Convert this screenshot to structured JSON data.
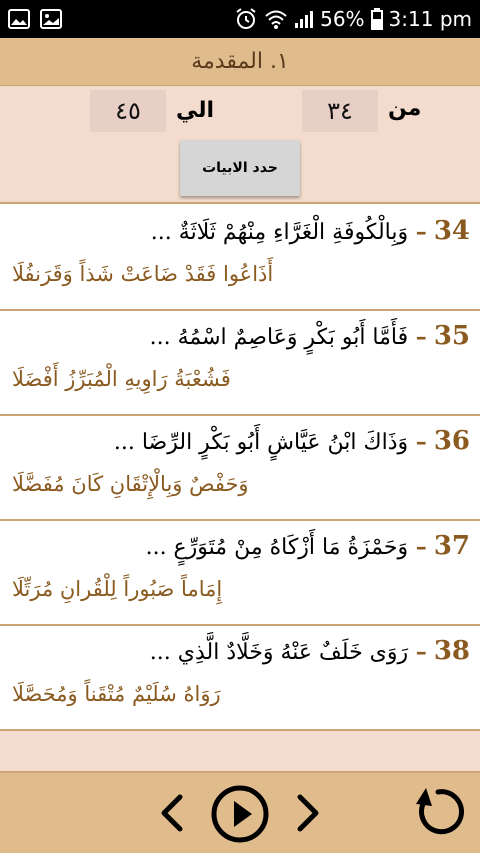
{
  "status_bar": {
    "battery_percent": "56%",
    "time": "3:11 pm",
    "icons": [
      "image-icon",
      "gallery-icon",
      "alarm-icon",
      "wifi-icon",
      "signal-icon",
      "battery-icon"
    ]
  },
  "header": {
    "title": "١. المقدمة"
  },
  "range": {
    "from_label": "من",
    "from_value": "٣٤",
    "to_label": "الي",
    "to_value": "٤٥",
    "button_label": "حدد الابيات"
  },
  "verses": [
    {
      "number": "34",
      "line1": "وَبِالْكُوفَةِ الْغَرَّاءِ مِنْهُمْ ثَلَاثَةٌ ...",
      "line2": "أَذَاعُوا فَقَدْ ضَاعَتْ شَذاً وَقَرَنفُلَا"
    },
    {
      "number": "35",
      "line1": "فَأَمَّا أَبُو بَكْرٍ وَعَاصِمٌ اسْمُهُ ...",
      "line2": "فَشُعْبَةُ رَاوِيهِ الْمُبَرِّزُ أَفْضَلَا"
    },
    {
      "number": "36",
      "line1": "وَذَاكَ ابْنُ عَيَّاشٍ أَبُو بَكْرٍ الرِّضَا ...",
      "line2": "وَحَفْصٌ وَبِالْإِتْقَانِ كَانَ مُفَضَّلَا"
    },
    {
      "number": "37",
      "line1": "وَحَمْزَةُ مَا أَزْكَاهُ مِنْ مُتَوَرِّعٍ ...",
      "line2": "إِمَاماً صَبُوراً لِلْقُرانِ مُرَتِّلَا"
    },
    {
      "number": "38",
      "line1": "رَوَى خَلَفٌ عَنْهُ وَخَلَّادٌ الَّذِي ...",
      "line2": "رَوَاهُ سُلَيْمٌ مُتْقَناً وَمُحَصَّلَا"
    }
  ],
  "colors": {
    "accent": "#e0bc8c",
    "panel": "#f3dccd",
    "verse_number": "#8a5a20",
    "divider": "#c9a574"
  },
  "toolbar": {
    "icons": [
      "chevron-left-icon",
      "play-icon",
      "chevron-right-icon",
      "replay-icon"
    ]
  }
}
